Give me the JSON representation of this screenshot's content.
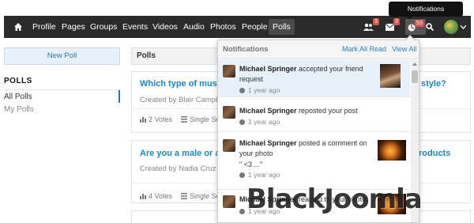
{
  "nav": {
    "items": [
      "Profile",
      "Pages",
      "Groups",
      "Events",
      "Videos",
      "Audio",
      "Photos",
      "People",
      "Polls"
    ],
    "active": "Polls",
    "friend_requests_count": "3",
    "messages_count": "3",
    "notifications_count": "53",
    "notifications_tooltip": "Notifications"
  },
  "sidebar": {
    "new_poll_label": "New Poll",
    "title": "POLLS",
    "items": [
      "All Polls",
      "My Polls"
    ]
  },
  "main": {
    "header": "Polls",
    "polls": [
      {
        "question_start": "Which type of music",
        "question_end": "style?",
        "created_by": "Created by Blair Campbe",
        "votes": "2 Votes",
        "type": "Single Se"
      },
      {
        "question_start": "Are you a male or a f",
        "question_end": "roducts",
        "created_by": "Created by Nadia Cruz",
        "votes": "4 Votes",
        "type": "Single Se"
      }
    ]
  },
  "notifications": {
    "title": "Notifications",
    "mark_all_read": "Mark All Read",
    "view_all": "View All",
    "items": [
      {
        "actor": "Michael Springer",
        "action": " accepted your friend request",
        "extra": "",
        "time": "1 year ago",
        "unread": true,
        "thumb": "person"
      },
      {
        "actor": "Michael Springer",
        "action": " reposted your post",
        "extra": "",
        "time": "1 year ago",
        "unread": false,
        "thumb": ""
      },
      {
        "actor": "Michael Springer",
        "action": " posted a comment on your photo",
        "extra": "\" <3 ...\"",
        "time": "1 year ago",
        "unread": false,
        "thumb": "sunset"
      },
      {
        "actor": "Michael Springer",
        "action": " reacted to your photo",
        "extra": "",
        "time": "1 year ago",
        "unread": false,
        "thumb": "sunset"
      }
    ]
  },
  "watermark": "BlackJoomla",
  "colors": {
    "navbar": "#2b2b2b",
    "link": "#1a86d0",
    "badge": "#d9534f",
    "unread_bg": "#e8f1f9"
  }
}
